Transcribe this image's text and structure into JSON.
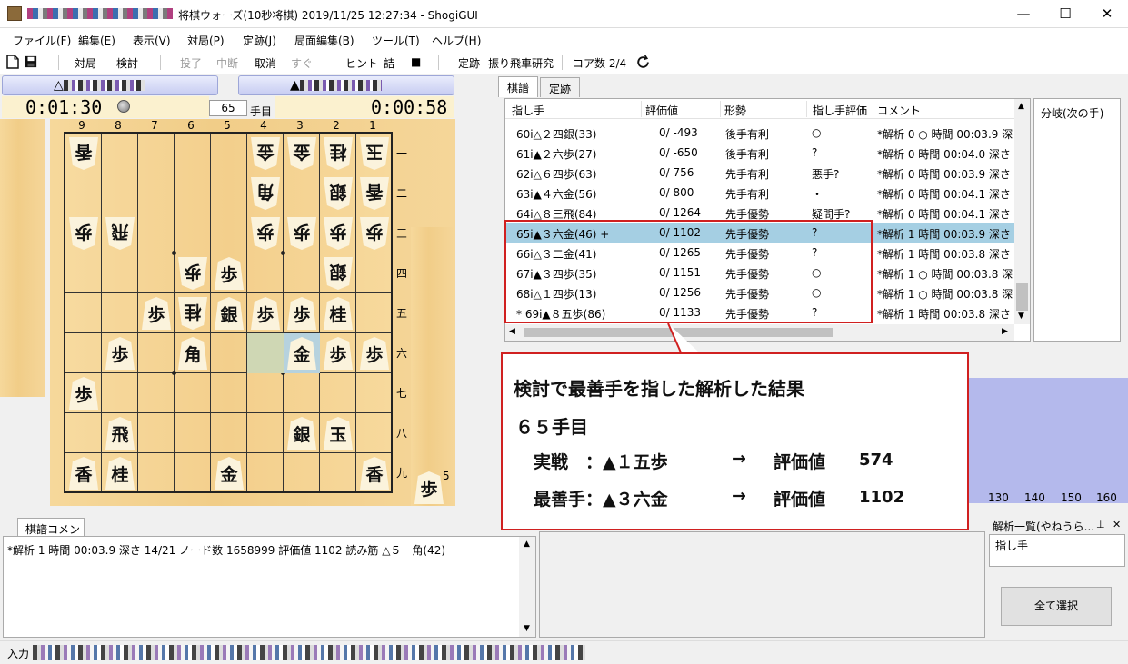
{
  "window": {
    "title": "将棋ウォーズ(10秒将棋) 2019/11/25 12:27:34 - ShogiGUI",
    "minimize": "—",
    "maximize": "☐",
    "close": "✕"
  },
  "menu": [
    "ファイル(F)",
    "編集(E)",
    "表示(V)",
    "対局(P)",
    "定跡(J)",
    "局面編集(B)",
    "ツール(T)",
    "ヘルプ(H)"
  ],
  "toolbar": {
    "items": [
      {
        "label": "対局",
        "enabled": true
      },
      {
        "label": "検討",
        "enabled": true
      },
      {
        "label": "投了",
        "enabled": false
      },
      {
        "label": "中断",
        "enabled": false
      },
      {
        "label": "取消",
        "enabled": true
      },
      {
        "label": "すぐ",
        "enabled": false
      },
      {
        "label": "ヒント",
        "enabled": true
      },
      {
        "label": "詰",
        "enabled": true
      },
      {
        "label": "■",
        "enabled": true
      },
      {
        "label": "定跡",
        "enabled": true
      }
    ],
    "book": "振り飛車研究",
    "cores": "コア数  2/4",
    "icons": [
      "new-file-icon",
      "save-icon",
      "refresh-icon"
    ]
  },
  "players": {
    "gote_mark": "△",
    "sente_mark": "▲"
  },
  "clocks": {
    "gote": "0:01:30",
    "sente": "0:00:58"
  },
  "move": {
    "number": "65",
    "suffix": "手目"
  },
  "board": {
    "files": [
      "9",
      "8",
      "7",
      "6",
      "5",
      "4",
      "3",
      "2",
      "1"
    ],
    "ranks": [
      "一",
      "二",
      "三",
      "四",
      "五",
      "六",
      "七",
      "八",
      "九"
    ],
    "pieces": [
      {
        "file": 9,
        "rank": 1,
        "char": "香",
        "gote": true
      },
      {
        "file": 4,
        "rank": 1,
        "char": "金",
        "gote": true
      },
      {
        "file": 3,
        "rank": 1,
        "char": "金",
        "gote": true
      },
      {
        "file": 2,
        "rank": 1,
        "char": "桂",
        "gote": true
      },
      {
        "file": 1,
        "rank": 1,
        "char": "玉",
        "gote": true
      },
      {
        "file": 4,
        "rank": 2,
        "char": "角",
        "gote": true
      },
      {
        "file": 2,
        "rank": 2,
        "char": "銀",
        "gote": true
      },
      {
        "file": 1,
        "rank": 2,
        "char": "香",
        "gote": true
      },
      {
        "file": 9,
        "rank": 3,
        "char": "歩",
        "gote": true
      },
      {
        "file": 8,
        "rank": 3,
        "char": "飛",
        "gote": true
      },
      {
        "file": 4,
        "rank": 3,
        "char": "歩",
        "gote": true
      },
      {
        "file": 3,
        "rank": 3,
        "char": "歩",
        "gote": true
      },
      {
        "file": 2,
        "rank": 3,
        "char": "歩",
        "gote": true
      },
      {
        "file": 1,
        "rank": 3,
        "char": "歩",
        "gote": true
      },
      {
        "file": 6,
        "rank": 4,
        "char": "歩",
        "gote": true
      },
      {
        "file": 5,
        "rank": 4,
        "char": "歩",
        "gote": false
      },
      {
        "file": 2,
        "rank": 4,
        "char": "銀",
        "gote": true
      },
      {
        "file": 7,
        "rank": 5,
        "char": "歩",
        "gote": false
      },
      {
        "file": 6,
        "rank": 5,
        "char": "桂",
        "gote": true
      },
      {
        "file": 5,
        "rank": 5,
        "char": "銀",
        "gote": false
      },
      {
        "file": 4,
        "rank": 5,
        "char": "歩",
        "gote": false
      },
      {
        "file": 3,
        "rank": 5,
        "char": "歩",
        "gote": false
      },
      {
        "file": 2,
        "rank": 5,
        "char": "桂",
        "gote": false
      },
      {
        "file": 8,
        "rank": 6,
        "char": "歩",
        "gote": false
      },
      {
        "file": 6,
        "rank": 6,
        "char": "角",
        "gote": false
      },
      {
        "file": 3,
        "rank": 6,
        "char": "金",
        "gote": false
      },
      {
        "file": 2,
        "rank": 6,
        "char": "歩",
        "gote": false
      },
      {
        "file": 1,
        "rank": 6,
        "char": "歩",
        "gote": false
      },
      {
        "file": 9,
        "rank": 7,
        "char": "歩",
        "gote": false
      },
      {
        "file": 8,
        "rank": 8,
        "char": "飛",
        "gote": false
      },
      {
        "file": 3,
        "rank": 8,
        "char": "銀",
        "gote": false
      },
      {
        "file": 2,
        "rank": 8,
        "char": "玉",
        "gote": false
      },
      {
        "file": 9,
        "rank": 9,
        "char": "香",
        "gote": false
      },
      {
        "file": 8,
        "rank": 9,
        "char": "桂",
        "gote": false
      },
      {
        "file": 5,
        "rank": 9,
        "char": "金",
        "gote": false
      },
      {
        "file": 1,
        "rank": 9,
        "char": "香",
        "gote": false
      }
    ],
    "highlight_from": {
      "file": 4,
      "rank": 6
    },
    "highlight_to": {
      "file": 3,
      "rank": 6
    },
    "sente_hand": {
      "char": "歩",
      "count": "5"
    }
  },
  "tabs": {
    "kifu": "棋譜",
    "joseki": "定跡"
  },
  "kifu": {
    "headers": [
      "指し手",
      "評価値",
      "形勢",
      "指し手評価",
      "コメント"
    ],
    "rows": [
      {
        "move": "60i△２四銀(33)",
        "eval": "0/  -493",
        "status": "後手有利",
        "mark": "○",
        "comment": "*解析 0 ○ 時間 00:03.9 深さ"
      },
      {
        "move": "61i▲２六歩(27)",
        "eval": "0/  -650",
        "status": "後手有利",
        "mark": "?",
        "comment": "*解析 0  時間 00:04.0 深さ"
      },
      {
        "move": "62i△６四歩(63)",
        "eval": "0/   756",
        "status": "先手有利",
        "mark": "悪手?",
        "comment": "*解析 0  時間 00:03.9 深さ"
      },
      {
        "move": "63i▲４六金(56)",
        "eval": "0/   800",
        "status": "先手有利",
        "mark": "・",
        "comment": "*解析 0  時間 00:04.1 深さ"
      },
      {
        "move": "64i△８三飛(84)",
        "eval": "0/  1264",
        "status": "先手優勢",
        "mark": "疑問手?",
        "comment": "*解析 0  時間 00:04.1 深さ"
      },
      {
        "move": "65i▲３六金(46) +",
        "eval": "0/  1102",
        "status": "先手優勢",
        "mark": "?",
        "comment": "*解析 1  時間 00:03.9 深さ"
      },
      {
        "move": "66i△３二金(41)",
        "eval": "0/  1265",
        "status": "先手優勢",
        "mark": "?",
        "comment": "*解析 1  時間 00:03.8 深さ"
      },
      {
        "move": "67i▲３四歩(35)",
        "eval": "0/  1151",
        "status": "先手優勢",
        "mark": "○",
        "comment": "*解析 1 ○ 時間 00:03.8 深さ"
      },
      {
        "move": "68i△１四歩(13)",
        "eval": "0/  1256",
        "status": "先手優勢",
        "mark": "○",
        "comment": "*解析 1 ○ 時間 00:03.8 深さ"
      },
      {
        "move": "* 69i▲８五歩(86)",
        "eval": "0/  1133",
        "status": "先手優勢",
        "mark": "?",
        "comment": "*解析 1  時間 00:03.8 深さ"
      }
    ],
    "selected_index": 5
  },
  "branch": {
    "title": "分岐(次の手)"
  },
  "graph": {
    "ticks": [
      "130",
      "140",
      "150",
      "160"
    ]
  },
  "callout": {
    "line1": "検討で最善手を指した解析した結果",
    "line2": "６５手目",
    "actual_label": "実戦　：▲１五歩",
    "best_label": "最善手：▲３六金",
    "arrow": "→",
    "eval_label": "評価値",
    "actual_value": "574",
    "best_value": "1102"
  },
  "comment": {
    "tab": "棋譜コメント",
    "text": "*解析 1  時間 00:03.9 深さ 14/21 ノード数 1658999 評価値 1102 読み筋 △５一角(42)"
  },
  "analysis_panel": {
    "title": "解析一覧(やねうら...",
    "pin": "⊥",
    "close": "✕",
    "header": "指し手",
    "select_all": "全て選択"
  },
  "input": {
    "label": "入力"
  },
  "colors": {
    "selected_row": "#a5cfe3",
    "callout_border": "#d02020",
    "graph_fill": "#b4b9ec",
    "board": "#f3cf8c"
  }
}
